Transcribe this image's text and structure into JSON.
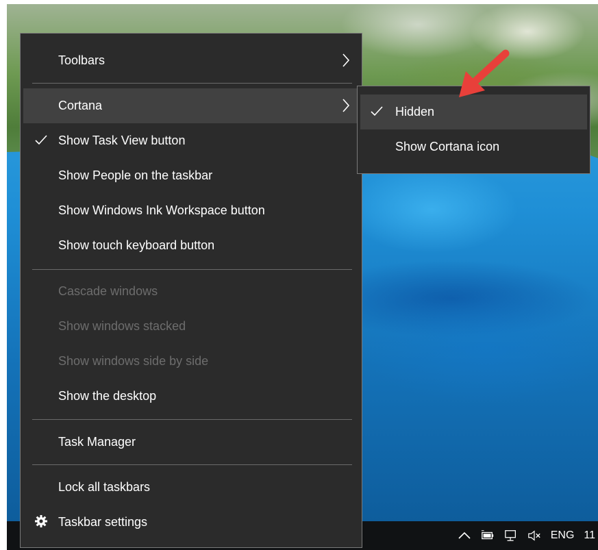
{
  "context_menu": {
    "items": [
      {
        "label": "Toolbars"
      },
      {
        "label": "Cortana"
      },
      {
        "label": "Show Task View button"
      },
      {
        "label": "Show People on the taskbar"
      },
      {
        "label": "Show Windows Ink Workspace button"
      },
      {
        "label": "Show touch keyboard button"
      },
      {
        "label": "Cascade windows"
      },
      {
        "label": "Show windows stacked"
      },
      {
        "label": "Show windows side by side"
      },
      {
        "label": "Show the desktop"
      },
      {
        "label": "Task Manager"
      },
      {
        "label": "Lock all taskbars"
      },
      {
        "label": "Taskbar settings"
      }
    ]
  },
  "submenu": {
    "items": [
      {
        "label": "Hidden"
      },
      {
        "label": "Show Cortana icon"
      }
    ]
  },
  "tray": {
    "language": "ENG",
    "clock_partial": "11"
  },
  "colors": {
    "menu_bg": "#2b2b2b",
    "hover_bg": "#414141",
    "disabled_text": "#6d6d6d",
    "arrow": "#e8403a",
    "taskbar": "#101214"
  }
}
